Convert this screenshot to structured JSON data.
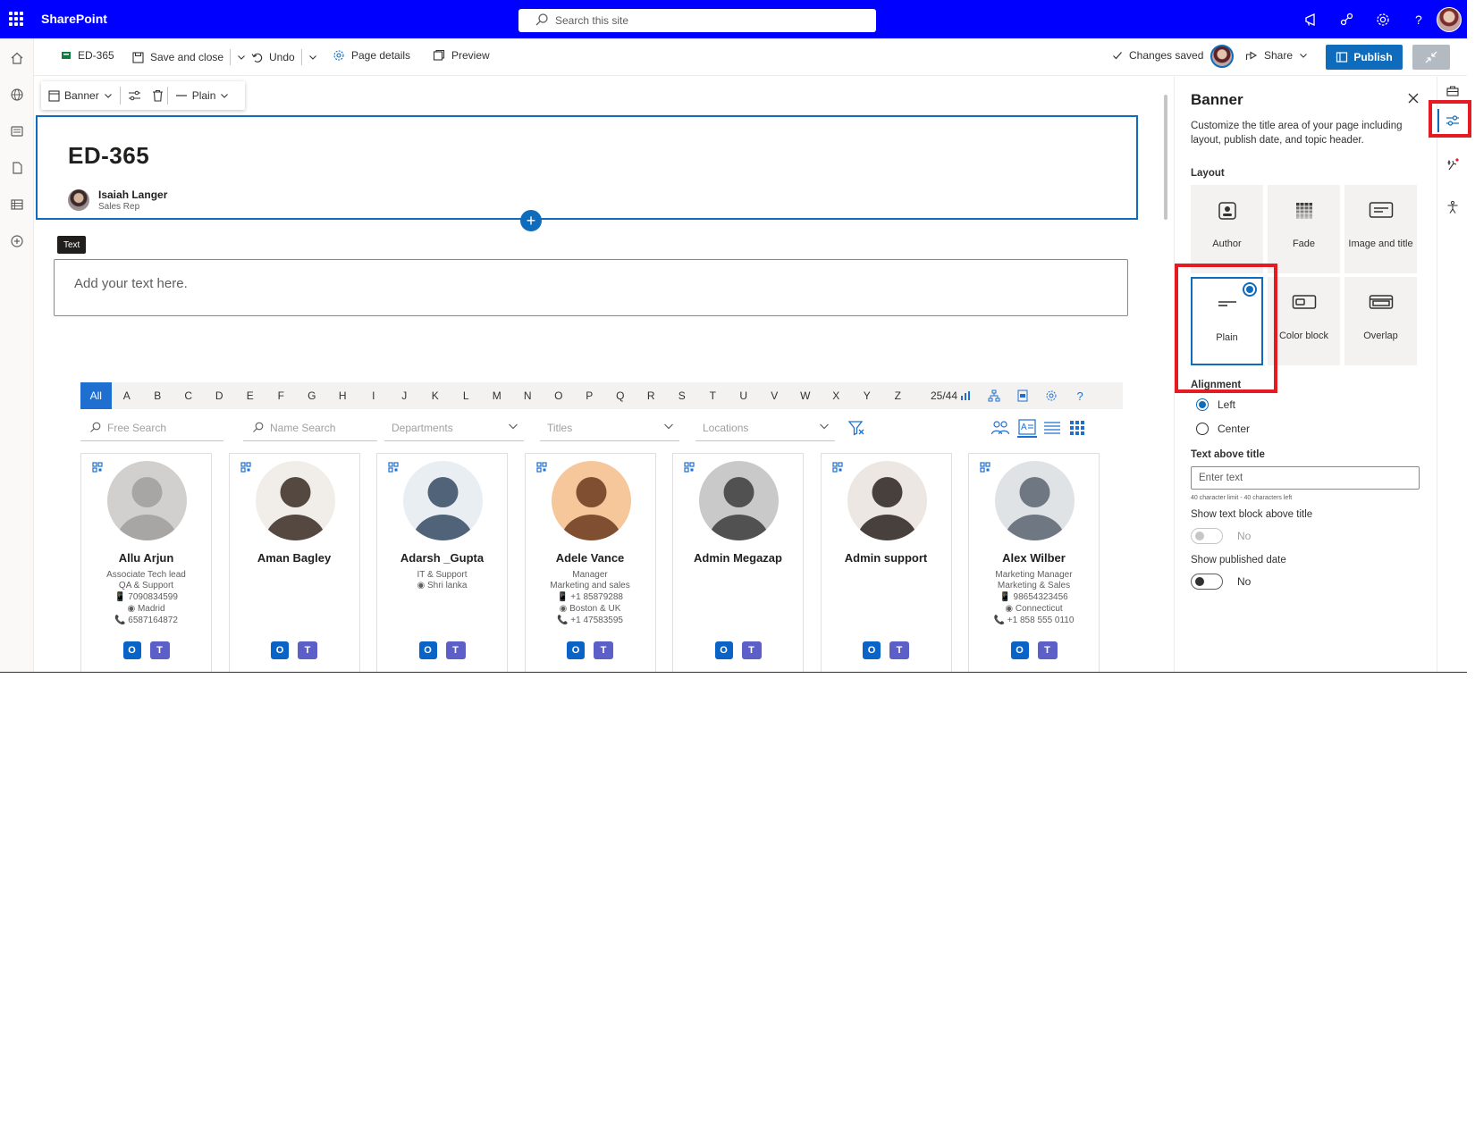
{
  "suite": {
    "brand": "SharePoint",
    "search_placeholder": "Search this site"
  },
  "command_bar": {
    "page_name": "ED-365",
    "save_close": "Save and close",
    "undo": "Undo",
    "page_details": "Page details",
    "preview": "Preview",
    "status": "Changes saved",
    "share": "Share",
    "publish": "Publish"
  },
  "section_toolbar": {
    "banner": "Banner",
    "layout": "Plain"
  },
  "banner": {
    "title": "ED-365",
    "author_name": "Isaiah Langer",
    "author_role": "Sales Rep"
  },
  "text_webpart": {
    "tag": "Text",
    "placeholder": "Add your text here."
  },
  "directory": {
    "letters": [
      "All",
      "A",
      "B",
      "C",
      "D",
      "E",
      "F",
      "G",
      "H",
      "I",
      "J",
      "K",
      "L",
      "M",
      "N",
      "O",
      "P",
      "Q",
      "R",
      "S",
      "T",
      "U",
      "V",
      "W",
      "X",
      "Y",
      "Z"
    ],
    "active_letter": "All",
    "count": "25/44",
    "filters": {
      "free_search": "Free Search",
      "name_search": "Name Search",
      "departments": "Departments",
      "titles": "Titles",
      "locations": "Locations"
    },
    "people": [
      {
        "name": "Allu Arjun",
        "lines": [
          "Associate Tech lead",
          "QA & Support",
          "📱 7090834599",
          "◉ Madrid",
          "📞 6587164872"
        ],
        "photo_colors": [
          "#d2d0ce",
          "#a19f9d"
        ]
      },
      {
        "name": "Aman Bagley",
        "lines": [],
        "photo_colors": [
          "#f1ede8",
          "#3a2a22"
        ]
      },
      {
        "name": "Adarsh _Gupta",
        "lines": [
          "IT & Support",
          "◉ Shri lanka"
        ],
        "photo_colors": [
          "#e9eef3",
          "#354a63"
        ]
      },
      {
        "name": "Adele Vance",
        "lines": [
          "Manager",
          "Marketing and sales",
          "📱 +1 85879288",
          "◉ Boston & UK",
          "📞 +1 47583595"
        ],
        "photo_colors": [
          "#f6c79b",
          "#6b3a1f"
        ]
      },
      {
        "name": "Admin Megazap",
        "lines": [],
        "photo_colors": [
          "#c9c9c9",
          "#3c3c3c"
        ]
      },
      {
        "name": "Admin support",
        "lines": [],
        "photo_colors": [
          "#ece7e2",
          "#2b2220"
        ]
      },
      {
        "name": "Alex Wilber",
        "lines": [
          "Marketing Manager",
          "Marketing & Sales",
          "📱 98654323456",
          "◉ Connecticut",
          "📞 +1 858 555 0110"
        ],
        "photo_colors": [
          "#dfe3e6",
          "#5a6470"
        ]
      }
    ]
  },
  "pane": {
    "title": "Banner",
    "description": "Customize the title area of your page including layout, publish date, and topic header.",
    "layout_label": "Layout",
    "layouts": [
      "Author",
      "Fade",
      "Image and title",
      "Plain",
      "Color block",
      "Overlap"
    ],
    "selected_layout": "Plain",
    "alignment_label": "Alignment",
    "alignment_options": [
      "Left",
      "Center"
    ],
    "selected_alignment": "Left",
    "text_above_title_label": "Text above title",
    "text_above_title_placeholder": "Enter text",
    "char_limit": "40 character limit - 40 characters left",
    "show_text_block_label": "Show text block above title",
    "show_text_block_value": "No",
    "show_published_label": "Show published date",
    "show_published_value": "No"
  },
  "colors": {
    "suite_bar": "#0000ff",
    "accent": "#0f6cbd",
    "highlight": "#e51b23"
  }
}
